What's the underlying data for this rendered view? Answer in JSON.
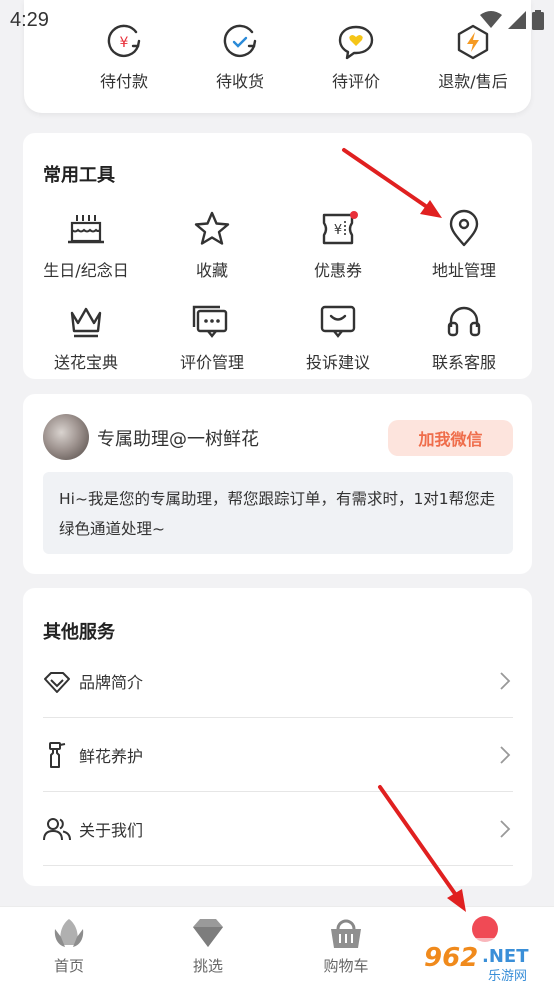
{
  "status_bar": {
    "time": "4:29"
  },
  "orders": [
    {
      "label": "待付款",
      "icon": "yen-refresh-icon"
    },
    {
      "label": "待收货",
      "icon": "check-refresh-icon"
    },
    {
      "label": "待评价",
      "icon": "heart-chat-icon"
    },
    {
      "label": "退款/售后",
      "icon": "lightning-hexagon-icon"
    }
  ],
  "tools": {
    "title": "常用工具",
    "items": [
      {
        "label": "生日/纪念日",
        "icon": "cake-icon"
      },
      {
        "label": "收藏",
        "icon": "star-icon"
      },
      {
        "label": "优惠券",
        "icon": "coupon-icon"
      },
      {
        "label": "地址管理",
        "icon": "location-pin-icon"
      },
      {
        "label": "送花宝典",
        "icon": "crown-icon"
      },
      {
        "label": "评价管理",
        "icon": "comment-icon"
      },
      {
        "label": "投诉建议",
        "icon": "feedback-icon"
      },
      {
        "label": "联系客服",
        "icon": "headphones-icon"
      }
    ]
  },
  "assistant": {
    "name": "专属助理@一树鲜花",
    "button": "加我微信",
    "message": "Hi~我是您的专属助理，帮您跟踪订单，有需求时，1对1帮您走绿色通道处理~"
  },
  "other_services": {
    "title": "其他服务",
    "items": [
      {
        "label": "品牌简介",
        "icon": "diamond-icon"
      },
      {
        "label": "鲜花养护",
        "icon": "spray-bottle-icon"
      },
      {
        "label": "关于我们",
        "icon": "users-icon"
      }
    ]
  },
  "bottom_nav": [
    {
      "label": "首页",
      "icon": "lotus-icon"
    },
    {
      "label": "挑选",
      "icon": "gem-icon"
    },
    {
      "label": "购物车",
      "icon": "basket-icon"
    }
  ],
  "watermark": {
    "text": "962.NET",
    "subtext": "乐游网"
  },
  "colors": {
    "accent": "#ef6d4b",
    "accent_bg": "#fde4dd",
    "badge": "#e8303a",
    "arrow": "#e02020"
  }
}
